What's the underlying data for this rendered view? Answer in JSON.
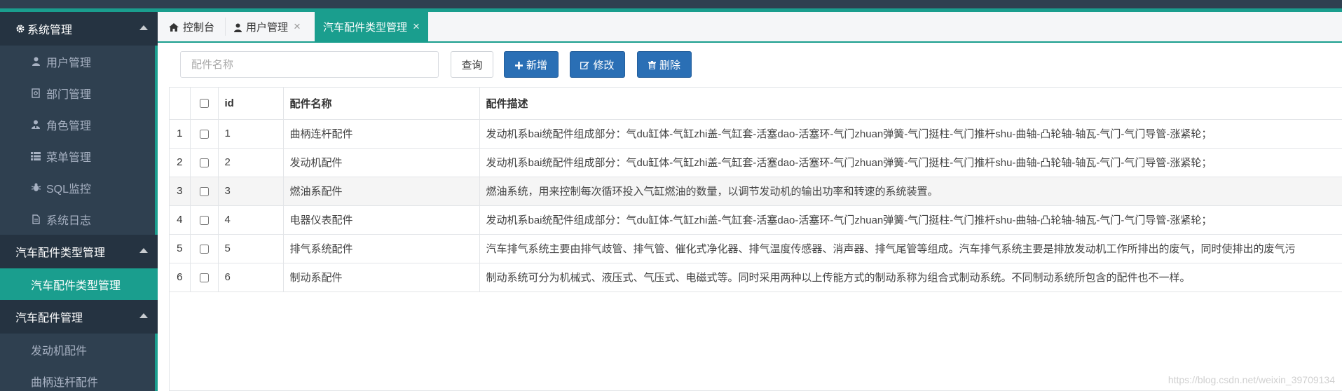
{
  "colors": {
    "sidebar_bg": "#2f4050",
    "accent": "#1a9e8e",
    "primary_button": "#2a6fb5"
  },
  "sidebar": {
    "groups": [
      {
        "title": "系统管理",
        "icon": "gear-icon",
        "items": [
          {
            "label": "用户管理",
            "icon": "user-icon"
          },
          {
            "label": "部门管理",
            "icon": "dept-icon"
          },
          {
            "label": "角色管理",
            "icon": "role-icon"
          },
          {
            "label": "菜单管理",
            "icon": "menu-list-icon"
          },
          {
            "label": "SQL监控",
            "icon": "bug-icon"
          },
          {
            "label": "系统日志",
            "icon": "file-icon"
          }
        ]
      },
      {
        "title": "汽车配件类型管理",
        "items": [
          {
            "label": "汽车配件类型管理",
            "active": true
          }
        ]
      },
      {
        "title": "汽车配件管理",
        "items": [
          {
            "label": "发动机配件"
          },
          {
            "label": "曲柄连杆配件"
          }
        ]
      }
    ]
  },
  "tabs": [
    {
      "label": "控制台",
      "icon": "home-icon"
    },
    {
      "label": "用户管理",
      "icon": "user-icon",
      "closable": true
    },
    {
      "label": "汽车配件类型管理",
      "closable": true,
      "active": true
    }
  ],
  "toolbar": {
    "search_placeholder": "配件名称",
    "query_label": "查询",
    "add_label": "新增",
    "edit_label": "修改",
    "delete_label": "删除"
  },
  "table": {
    "columns": [
      "id",
      "配件名称",
      "配件描述"
    ],
    "rows": [
      {
        "index": "1",
        "id": "1",
        "name": "曲柄连杆配件",
        "desc": "发动机系bai统配件组成部分：气du缸体-气缸zhi盖-气缸套-活塞dao-活塞环-气门zhuan弹簧-气门挺柱-气门推杆shu-曲轴-凸轮轴-轴瓦-气门-气门导管-涨紧轮；"
      },
      {
        "index": "2",
        "id": "2",
        "name": "发动机配件",
        "desc": "发动机系bai统配件组成部分：气du缸体-气缸zhi盖-气缸套-活塞dao-活塞环-气门zhuan弹簧-气门挺柱-气门推杆shu-曲轴-凸轮轴-轴瓦-气门-气门导管-涨紧轮；"
      },
      {
        "index": "3",
        "id": "3",
        "name": "燃油系配件",
        "desc": "燃油系统，用来控制每次循环投入气缸燃油的数量，以调节发动机的输出功率和转速的系统装置。"
      },
      {
        "index": "4",
        "id": "4",
        "name": "电器仪表配件",
        "desc": "发动机系bai统配件组成部分：气du缸体-气缸zhi盖-气缸套-活塞dao-活塞环-气门zhuan弹簧-气门挺柱-气门推杆shu-曲轴-凸轮轴-轴瓦-气门-气门导管-涨紧轮；"
      },
      {
        "index": "5",
        "id": "5",
        "name": "排气系统配件",
        "desc": "汽车排气系统主要由排气歧管、排气管、催化式净化器、排气温度传感器、消声器、排气尾管等组成。汽车排气系统主要是排放发动机工作所排出的废气，同时使排出的废气污"
      },
      {
        "index": "6",
        "id": "6",
        "name": "制动系配件",
        "desc": "制动系统可分为机械式、液压式、气压式、电磁式等。同时采用两种以上传能方式的制动系称为组合式制动系统。不同制动系统所包含的配件也不一样。"
      }
    ]
  },
  "watermark": "https://blog.csdn.net/weixin_39709134"
}
